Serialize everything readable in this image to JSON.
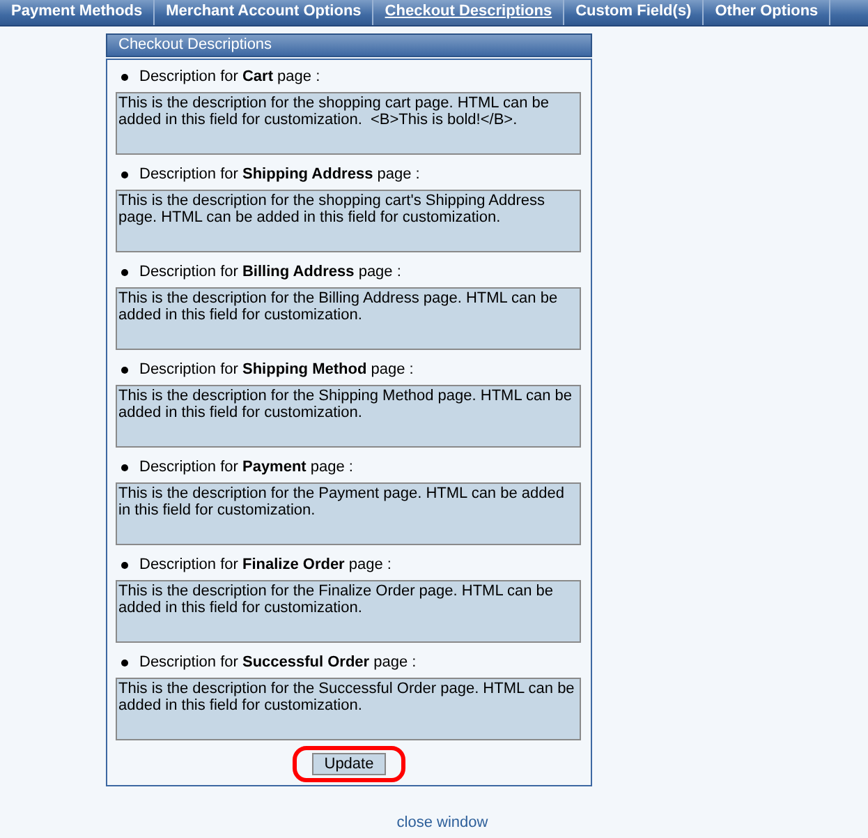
{
  "tabs": [
    {
      "label": "Payment Methods",
      "selected": false
    },
    {
      "label": "Merchant Account Options",
      "selected": false
    },
    {
      "label": "Checkout Descriptions",
      "selected": true
    },
    {
      "label": "Custom Field(s)",
      "selected": false
    },
    {
      "label": "Other Options",
      "selected": false
    }
  ],
  "panel": {
    "title": "Checkout Descriptions",
    "items": [
      {
        "label": "Description for **Cart** page :",
        "value": "This is the description for the shopping cart page. HTML can be added in this field for customization.  <B>This is bold!</B>."
      },
      {
        "label": "Description for **Shipping Address** page :",
        "value": "This is the description for the shopping cart's Shipping Address page. HTML can be added in this field for customization."
      },
      {
        "label": "Description for **Billing Address** page :",
        "value": "This is the description for the Billing Address page. HTML can be added in this field for customization."
      },
      {
        "label": "Description for **Shipping Method** page :",
        "value": "This is the description for the Shipping Method page. HTML can be added in this field for customization."
      },
      {
        "label": "Description for **Payment** page :",
        "value": "This is the description for the Payment page. HTML can be added in this field for customization."
      },
      {
        "label": "Description for **Finalize Order** page :",
        "value": "This is the description for the Finalize Order page. HTML can be added in this field for customization."
      },
      {
        "label": "Description for **Successful Order** page :",
        "value": "This is the description for the Successful Order page. HTML can be added in this field for customization."
      }
    ],
    "button": "Update"
  },
  "footer_link": "close window"
}
